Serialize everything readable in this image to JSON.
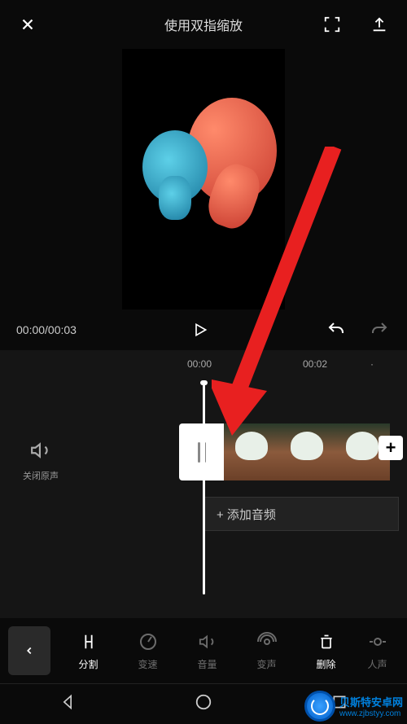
{
  "topbar": {
    "hint": "使用双指缩放"
  },
  "controls": {
    "time_display": "00:00/00:03"
  },
  "ruler": {
    "marks": [
      "00:00",
      "00:02"
    ]
  },
  "mute": {
    "label": "关闭原声"
  },
  "audio_row": {
    "label": "+  添加音频"
  },
  "toolbar": {
    "items": [
      {
        "label": "分割",
        "active": true
      },
      {
        "label": "变速",
        "active": false
      },
      {
        "label": "音量",
        "active": false
      },
      {
        "label": "变声",
        "active": false
      },
      {
        "label": "删除",
        "active": true
      },
      {
        "label": "人声",
        "active": false
      }
    ]
  },
  "watermark": {
    "main": "贝斯特安卓网",
    "sub": "www.zjbstyy.com"
  }
}
